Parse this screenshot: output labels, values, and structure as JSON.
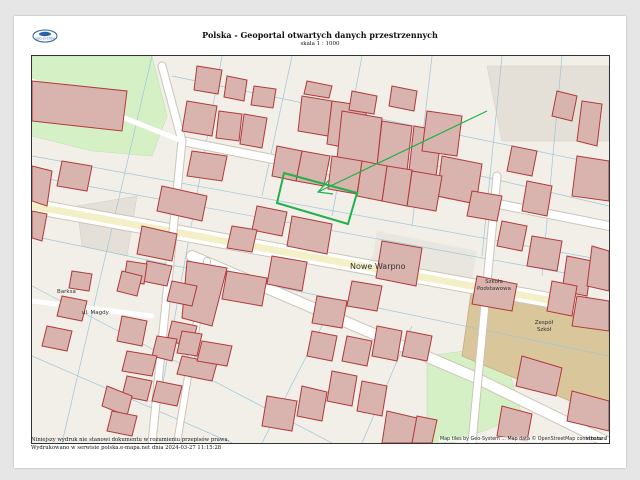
{
  "header": {
    "logo_text": "GEO-SYSTEM",
    "title": "Polska - Geoportal otwartych danych przestrzennych",
    "scale": "skala 1 : 1000"
  },
  "map": {
    "labels": {
      "town": "Nowe Warpno",
      "barksa": "Barksa",
      "magdy": "ul. Magdy",
      "school_1": "Szkoła",
      "school_2": "Podstawowa",
      "complex_1": "Zespół",
      "complex_2": "Szkół"
    },
    "attribution": "Map tiles by Geo-System ... Map data © OpenStreetMap contributors",
    "colors": {
      "background": "#f2efe9",
      "building_fill": "#d9b3ae",
      "building_stroke": "#b03a3a",
      "road": "#ffffff",
      "main_road": "#f3f0c7",
      "green": "#d6f0c6",
      "school": "#d9c69a",
      "parcel_lines": "#9cc6d9",
      "highlight": "#22b14c"
    }
  },
  "footer": {
    "line1": "Niniejszy wydruk nie stanowi dokumentu w rozumieniu przepisów prawa.",
    "line2": "Wydrukowano w serwisie polska.e-mapa.net dnia 2024-03-27 11:15:28",
    "page": "strona 1"
  }
}
